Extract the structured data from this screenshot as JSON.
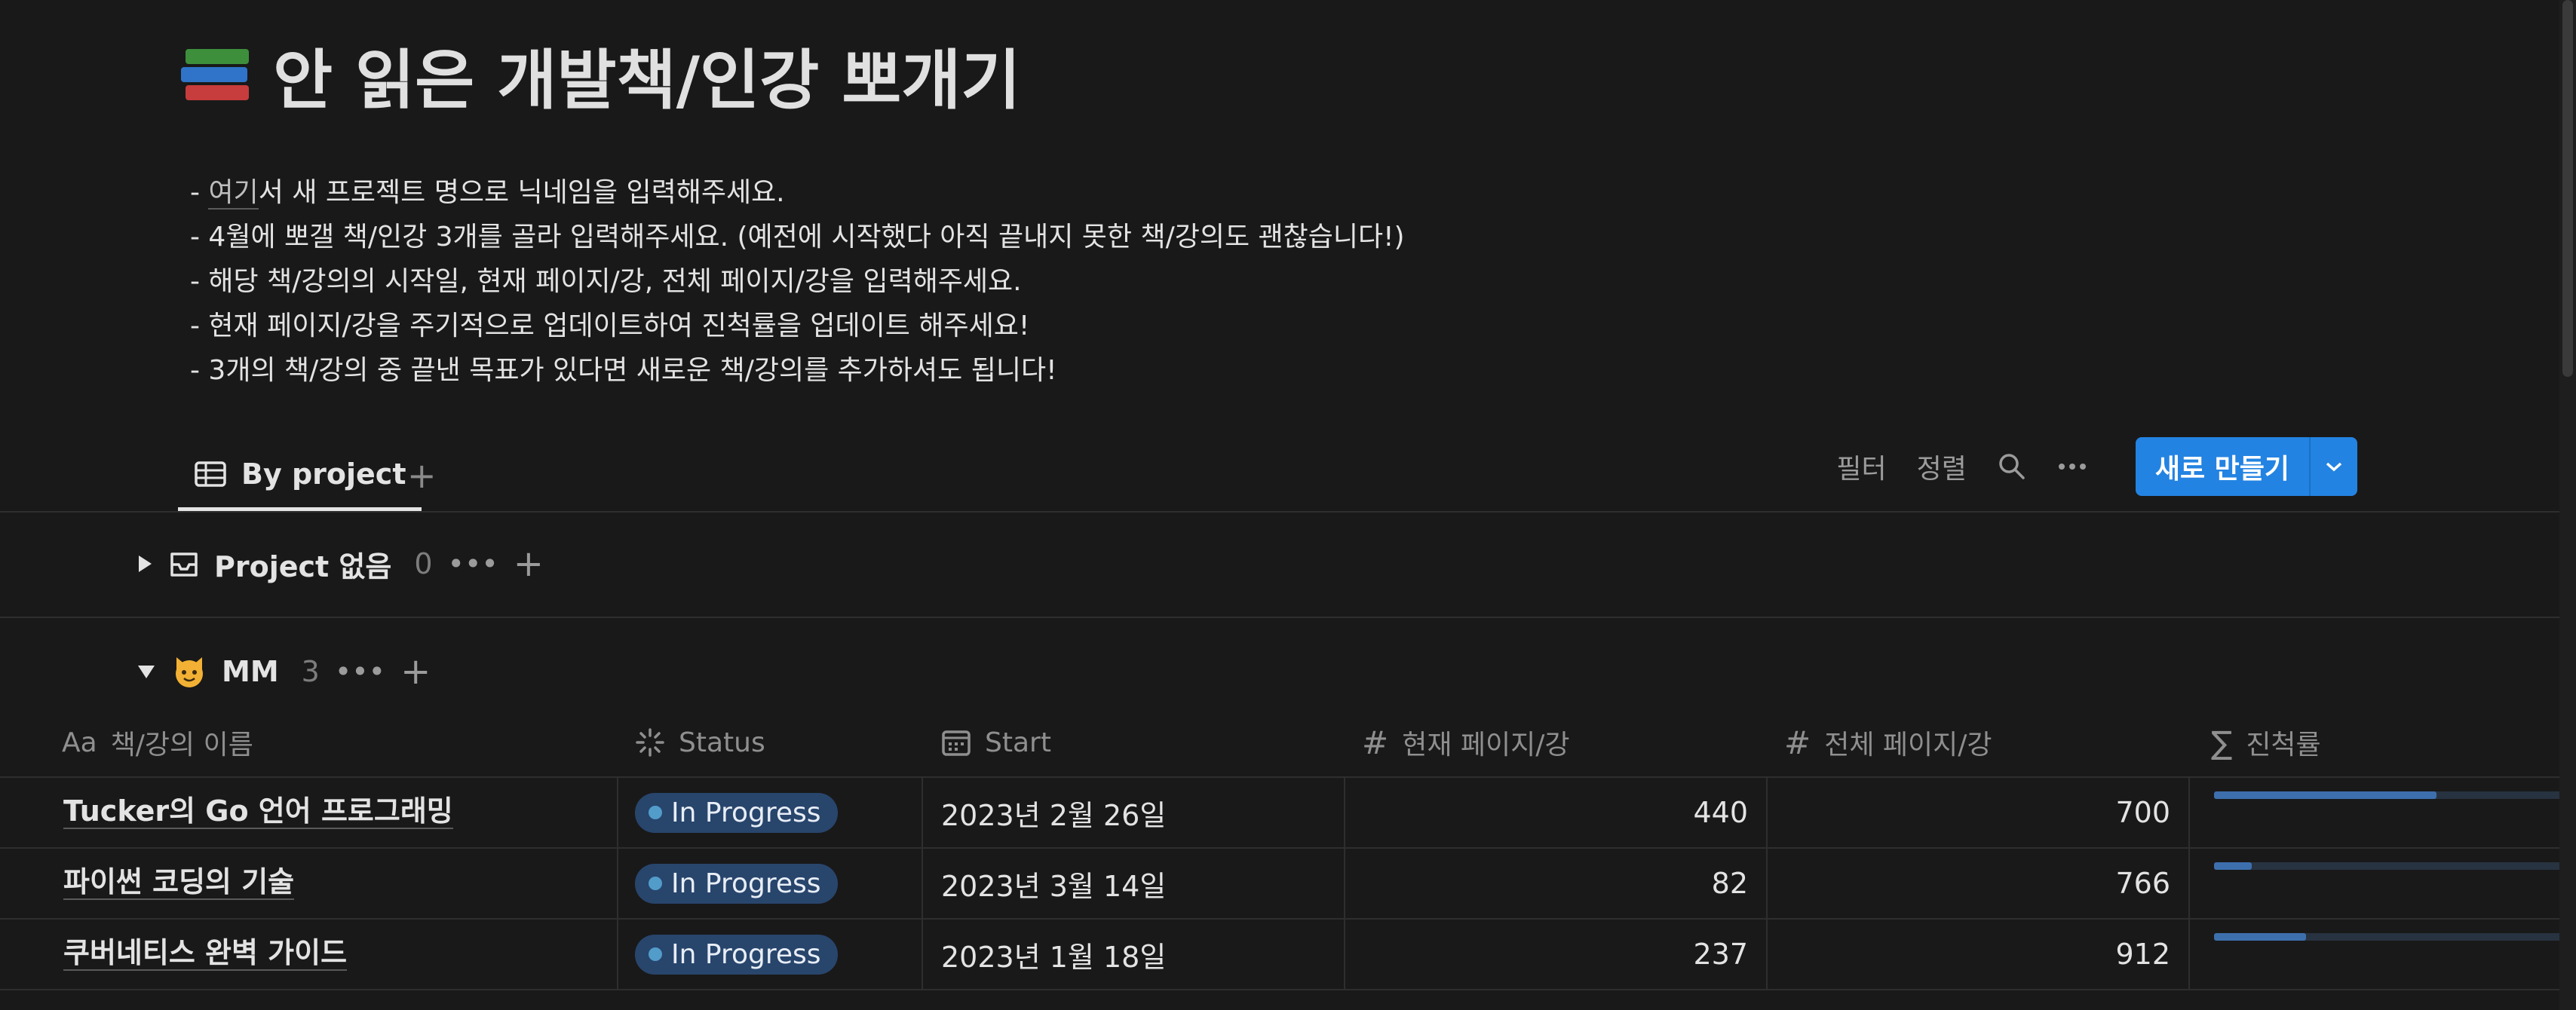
{
  "page": {
    "title": "안 읽은 개발책/인강 뽀개기",
    "title_icon": "books-emoji"
  },
  "description": {
    "line1_prefix": "- ",
    "line1_link": "여기",
    "line1_rest": "서 새 프로젝트 명으로 닉네임을 입력해주세요.",
    "line2": "- 4월에 뽀갤 책/인강 3개를 골라 입력해주세요. (예전에 시작했다 아직 끝내지 못한 책/강의도 괜찮습니다!)",
    "line3": "- 해당 책/강의의 시작일, 현재 페이지/강, 전체 페이지/강을 입력해주세요.",
    "line4": "- 현재 페이지/강을 주기적으로 업데이트하여 진척률을 업데이트 해주세요!",
    "line5": "- 3개의 책/강의 중 끝낸 목표가 있다면 새로운 책/강의를 추가하셔도 됩니다!"
  },
  "toolbar": {
    "view_tab": "By project",
    "filter": "필터",
    "sort": "정렬",
    "new_button": "새로 만들기"
  },
  "groups": [
    {
      "name": "Project 없음",
      "count": "0",
      "expanded": false,
      "icon": "inbox-icon"
    },
    {
      "name": "MM",
      "count": "3",
      "expanded": true,
      "icon": "cat-emoji"
    }
  ],
  "columns": {
    "name": "책/강의 이름",
    "name_prefix": "Aa",
    "status": "Status",
    "start": "Start",
    "current": "현재 페이지/강",
    "total": "전체 페이지/강",
    "progress": "진척률"
  },
  "rows": [
    {
      "name": "Tucker의 Go 언어 프로그래밍",
      "status": "In Progress",
      "start": "2023년 2월 26일",
      "current": "440",
      "total": "700",
      "progress": 0.628
    },
    {
      "name": "파이썬 코딩의 기술",
      "status": "In Progress",
      "start": "2023년 3월 14일",
      "current": "82",
      "total": "766",
      "progress": 0.107
    },
    {
      "name": "쿠버네티스 완벽 가이드",
      "status": "In Progress",
      "start": "2023년 1월 18일",
      "current": "237",
      "total": "912",
      "progress": 0.26
    }
  ],
  "colors": {
    "background": "#191919",
    "accent": "#2383e2",
    "status_pill": "#28456c",
    "progress_bar": "#3d6fad"
  }
}
